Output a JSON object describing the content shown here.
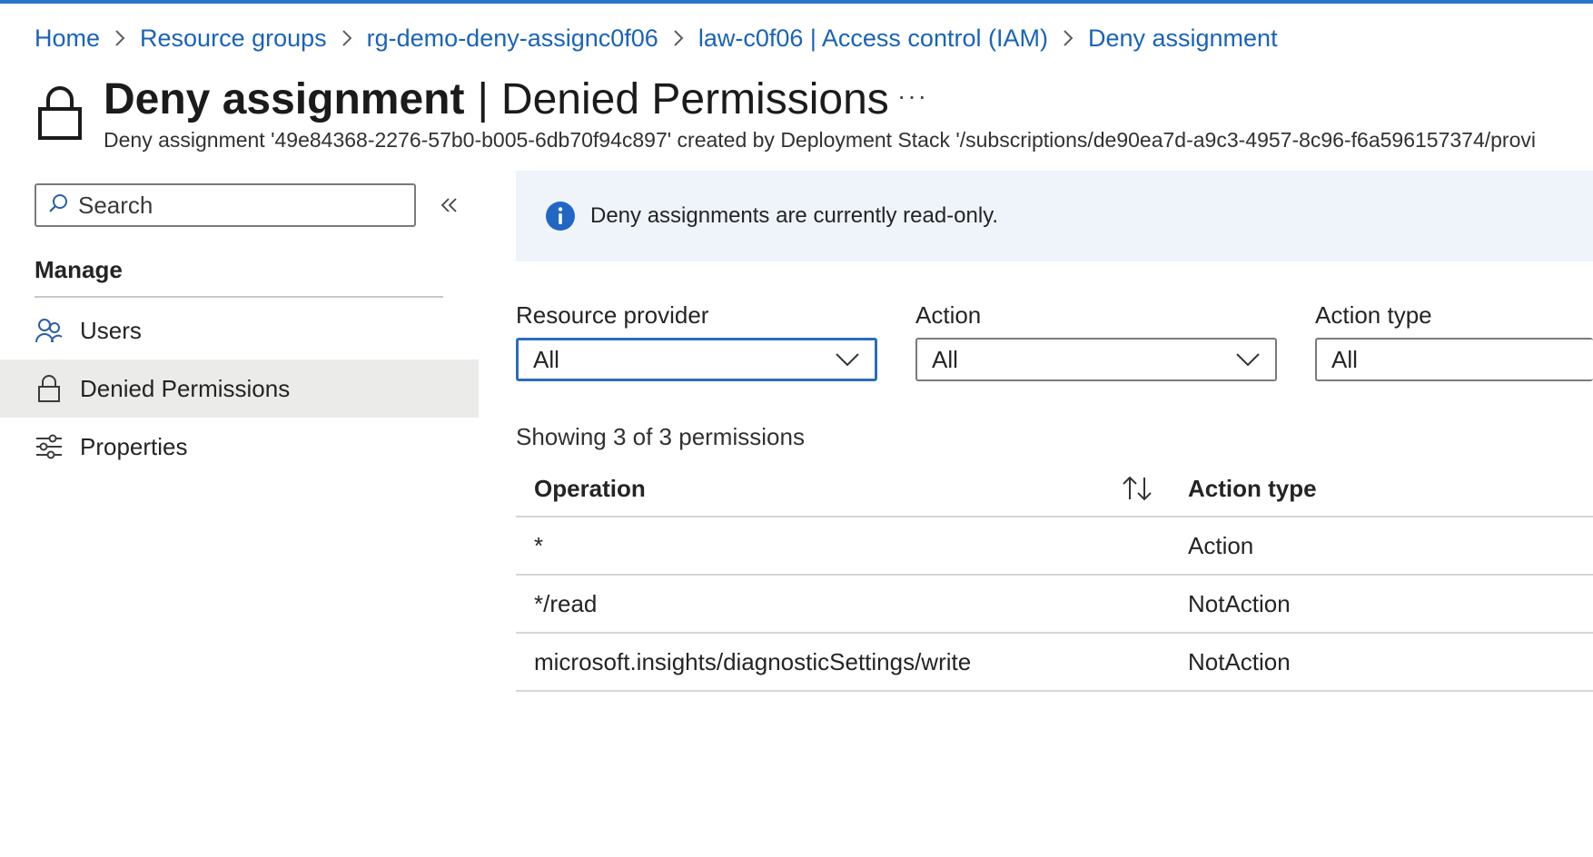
{
  "breadcrumb": [
    {
      "label": "Home"
    },
    {
      "label": "Resource groups"
    },
    {
      "label": "rg-demo-deny-assignc0f06"
    },
    {
      "label": "law-c0f06 | Access control (IAM)"
    },
    {
      "label": "Deny assignment"
    }
  ],
  "header": {
    "icon": "lock-icon",
    "title_bold": "Deny assignment",
    "title_sep": "|",
    "title_rest": "Denied Permissions",
    "more": "···",
    "subtitle": "Deny assignment '49e84368-2276-57b0-b005-6db70f94c897' created by Deployment Stack '/subscriptions/de90ea7d-a9c3-4957-8c96-f6a596157374/provi"
  },
  "sidebar": {
    "search_placeholder": "Search",
    "section": "Manage",
    "items": [
      {
        "label": "Users",
        "icon": "users-icon",
        "active": false
      },
      {
        "label": "Denied Permissions",
        "icon": "lock-icon",
        "active": true
      },
      {
        "label": "Properties",
        "icon": "sliders-icon",
        "active": false
      }
    ]
  },
  "banner": {
    "icon": "info-icon",
    "text": "Deny assignments are currently read-only."
  },
  "filters": [
    {
      "label": "Resource provider",
      "value": "All"
    },
    {
      "label": "Action",
      "value": "All"
    },
    {
      "label": "Action type",
      "value": "All"
    }
  ],
  "count_text": "Showing 3 of 3 permissions",
  "table": {
    "columns": [
      "Operation",
      "Action type"
    ],
    "rows": [
      {
        "operation": "*",
        "action_type": "Action"
      },
      {
        "operation": "*/read",
        "action_type": "NotAction"
      },
      {
        "operation": "microsoft.insights/diagnosticSettings/write",
        "action_type": "NotAction"
      }
    ]
  },
  "colors": {
    "accent": "#1a63b8",
    "focus_border": "#2d6cc0",
    "info_blue": "#2266c4",
    "banner_bg": "#eff4fb",
    "active_nav_bg": "#ebebea"
  }
}
